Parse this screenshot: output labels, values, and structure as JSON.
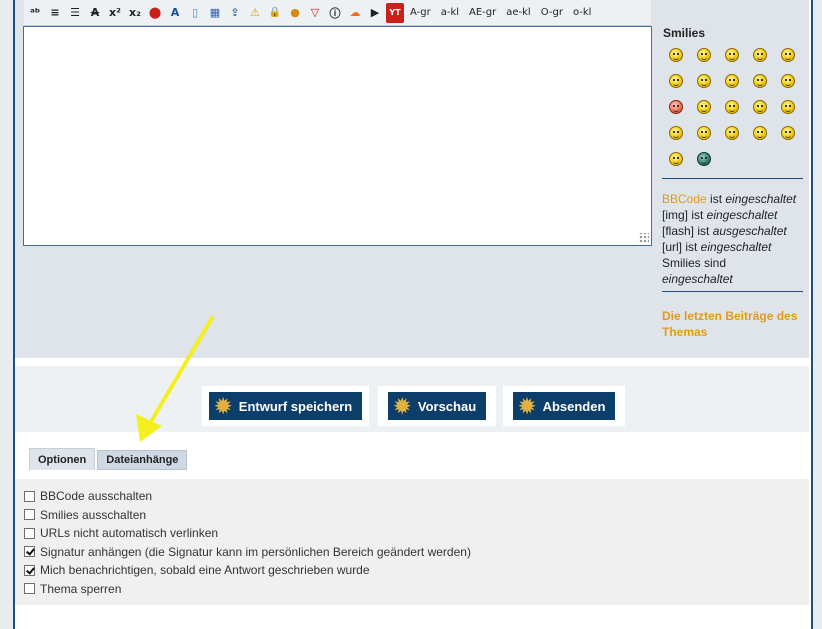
{
  "toolbar": {
    "icons": [
      "spellcheck-icon",
      "align-justify-icon",
      "align-left-icon",
      "strikethrough-icon",
      "superscript-icon",
      "subscript-icon",
      "acrobat-icon",
      "font-icon",
      "glass-icon",
      "gradient-icon",
      "upload-icon",
      "warning-icon",
      "lock-icon",
      "speech-icon",
      "down-arrow-icon",
      "info-icon",
      "soundcloud-icon",
      "play-icon",
      "youtube-icon"
    ],
    "glyphs": [
      "ᵃᵇ",
      "≡",
      "☰",
      "A",
      "x²",
      "x₂",
      "⬤",
      "A",
      "▯",
      "▦",
      "⇪",
      "⚠",
      "🔒",
      "●",
      "▽",
      "ⓘ",
      "☁",
      "▶",
      "YT"
    ],
    "text_buttons": [
      "A-gr",
      "a-kl",
      "AE-gr",
      "ae-kl",
      "O-gr",
      "o-kl"
    ]
  },
  "side": {
    "smilies_title": "Smilies",
    "smilies": [
      "smile",
      "grin",
      "sad",
      "surprised",
      "eek",
      "neutral",
      "cool",
      "happy",
      "confused",
      "razz",
      "mad",
      "frown",
      "evil",
      "twisted",
      "rolleyes",
      "wink",
      "exclaim",
      "question",
      "idea",
      "arrow",
      "neutral2",
      "alien"
    ],
    "bbcode_link": "BBCode",
    "bbcode_rest_pre": " ist ",
    "bbcode_state": "eingeschaltet",
    "img_label": "[img] ist ",
    "img_state": "eingeschaltet",
    "flash_label": "[flash] ist ",
    "flash_state": "ausgeschaltet",
    "url_label": "[url] ist ",
    "url_state": "eingeschaltet",
    "smilies_label": "Smilies sind",
    "smilies_state": "eingeschaltet",
    "last_posts": "Die letzten Beiträge des Themas"
  },
  "buttons": {
    "draft": "Entwurf speichern",
    "preview": "Vorschau",
    "submit": "Absenden"
  },
  "tabs": {
    "options": "Optionen",
    "attachments": "Dateianhänge"
  },
  "options": [
    {
      "label": "BBCode ausschalten",
      "checked": false
    },
    {
      "label": "Smilies ausschalten",
      "checked": false
    },
    {
      "label": "URLs nicht automatisch verlinken",
      "checked": false
    },
    {
      "label": "Signatur anhängen (die Signatur kann im persönlichen Bereich geändert werden)",
      "checked": true
    },
    {
      "label": "Mich benachrichtigen, sobald eine Antwort geschrieben wurde",
      "checked": true
    },
    {
      "label": "Thema sperren",
      "checked": false
    }
  ],
  "colors": {
    "accent": "#e39a19",
    "button_bg": "#0c3e6b",
    "arrow": "#f5ef1f"
  }
}
